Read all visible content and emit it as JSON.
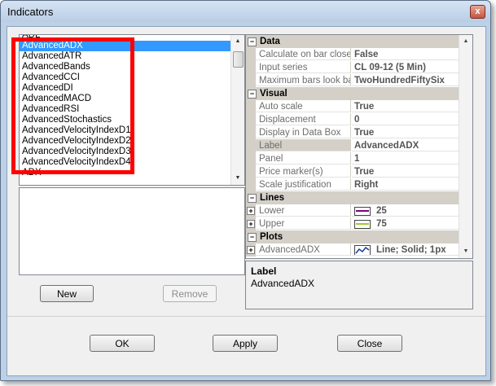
{
  "window": {
    "title": "Indicators",
    "close_label": "x"
  },
  "indicator_list": {
    "items": [
      "ADL",
      "AdvancedADX",
      "AdvancedATR",
      "AdvancedBands",
      "AdvancedCCI",
      "AdvancedDI",
      "AdvancedMACD",
      "AdvancedRSI",
      "AdvancedStochastics",
      "AdvancedVelocityIndexD1",
      "AdvancedVelocityIndexD2",
      "AdvancedVelocityIndexD3",
      "AdvancedVelocityIndexD4",
      "ADX"
    ],
    "selected": "AdvancedADX"
  },
  "buttons": {
    "new": "New",
    "remove": "Remove",
    "ok": "OK",
    "apply": "Apply",
    "close": "Close"
  },
  "properties": {
    "data": {
      "category": "Data",
      "rows": [
        {
          "name": "Calculate on bar close",
          "value": "False"
        },
        {
          "name": "Input series",
          "value": "CL 09-12 (5 Min)"
        },
        {
          "name": "Maximum bars look ba",
          "value": "TwoHundredFiftySix"
        }
      ]
    },
    "visual": {
      "category": "Visual",
      "rows": [
        {
          "name": "Auto scale",
          "value": "True"
        },
        {
          "name": "Displacement",
          "value": "0"
        },
        {
          "name": "Display in Data Box",
          "value": "True"
        },
        {
          "name": "Label",
          "value": "AdvancedADX"
        },
        {
          "name": "Panel",
          "value": "1"
        },
        {
          "name": "Price marker(s)",
          "value": "True"
        },
        {
          "name": "Scale justification",
          "value": "Right"
        }
      ]
    },
    "lines": {
      "category": "Lines",
      "rows": [
        {
          "name": "Lower",
          "value": "25",
          "color": "#800080"
        },
        {
          "name": "Upper",
          "value": "75",
          "color": "#9acd32"
        }
      ]
    },
    "plots": {
      "category": "Plots",
      "rows": [
        {
          "name": "AdvancedADX",
          "value": "Line; Solid; 1px",
          "color": "#1a3d8f"
        }
      ]
    }
  },
  "description": {
    "title": "Label",
    "text": "AdvancedADX"
  },
  "annotation": {
    "color": "#ff0000"
  }
}
